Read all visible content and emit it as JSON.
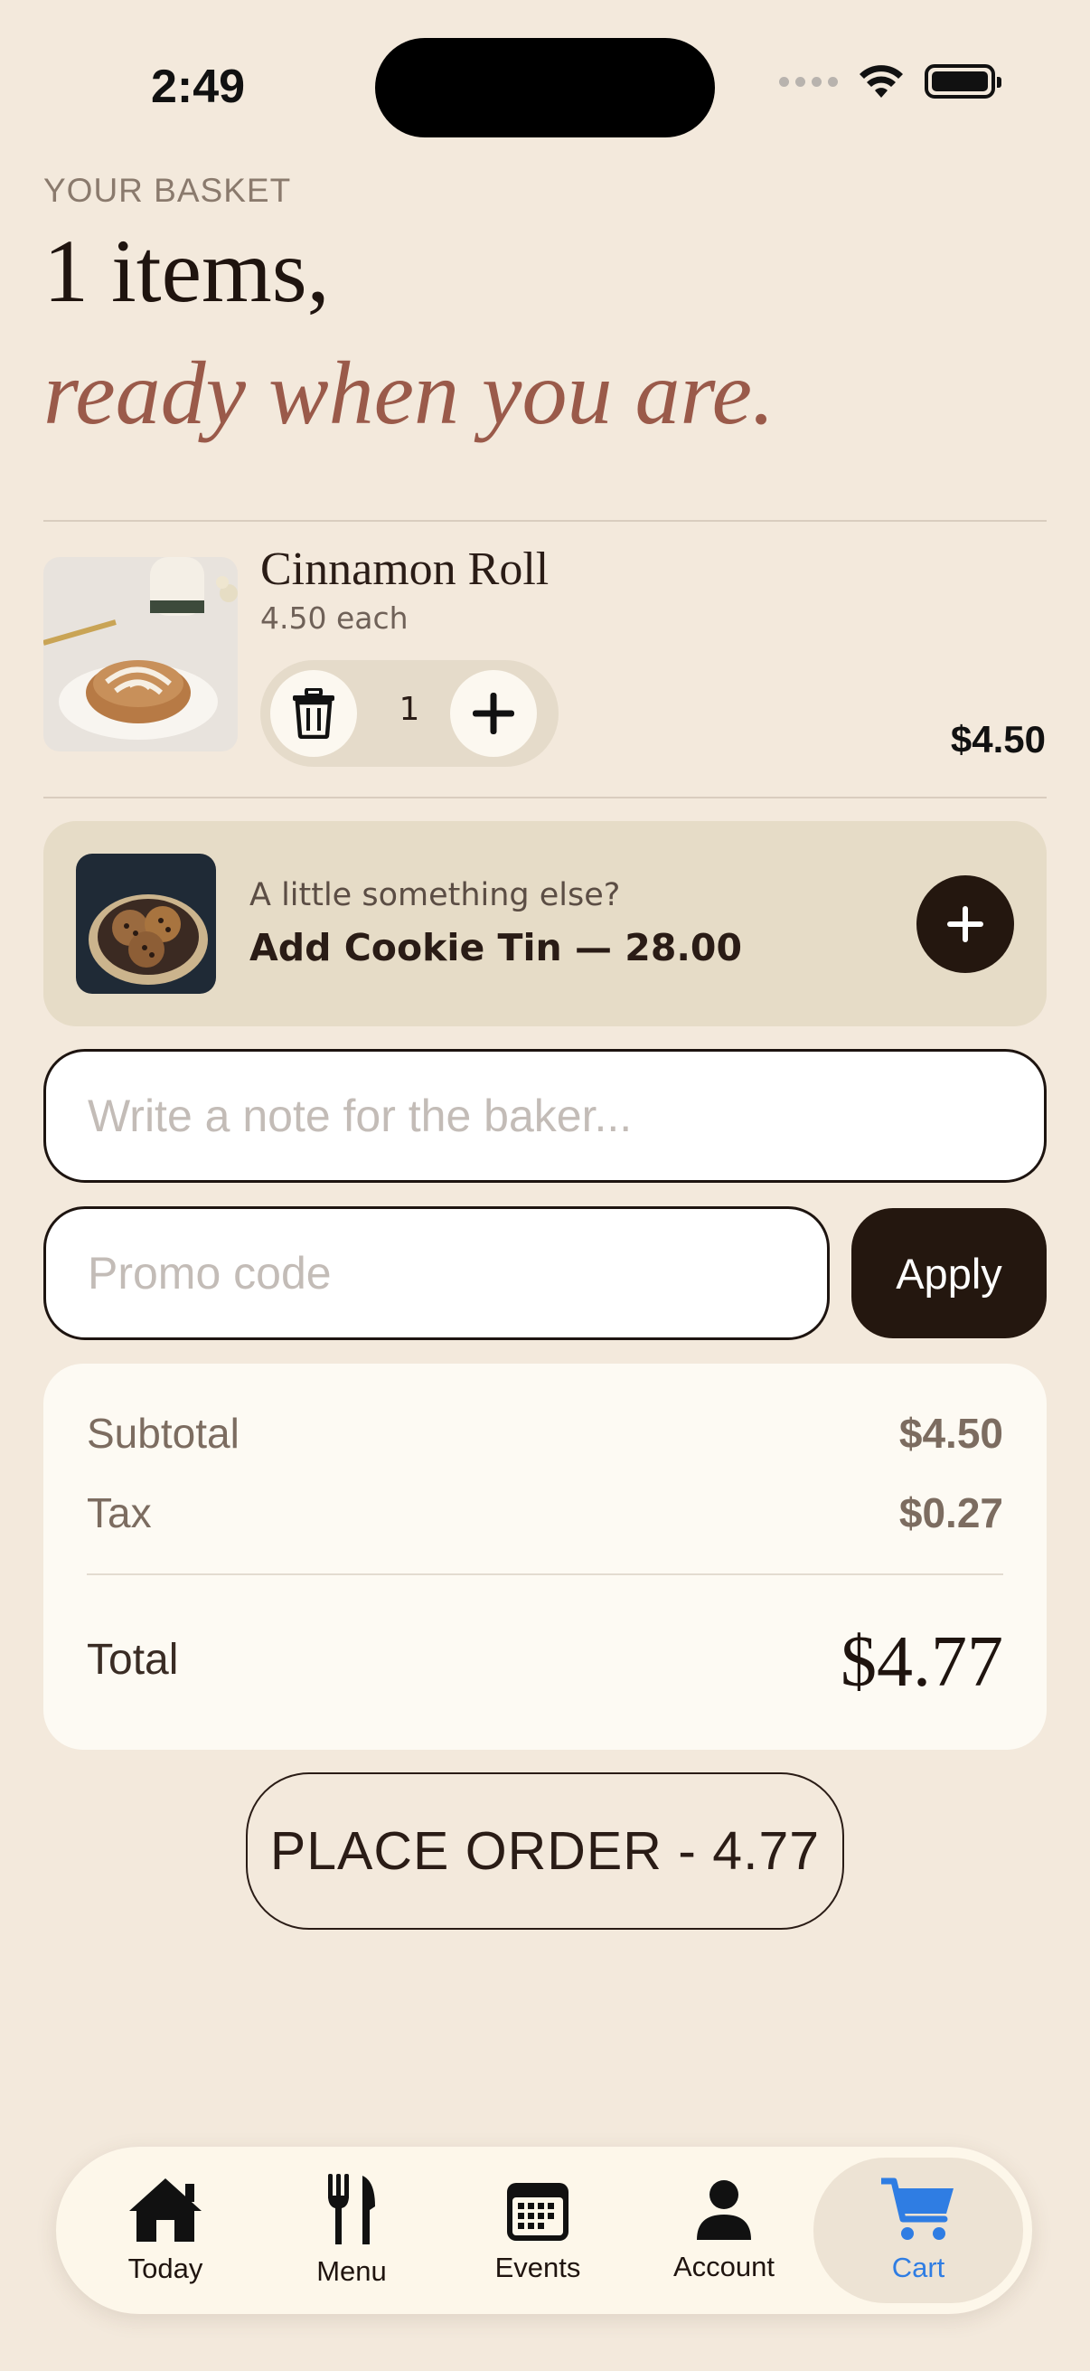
{
  "status_bar": {
    "time": "2:49"
  },
  "header": {
    "eyebrow": "YOUR BASKET",
    "headline": "1 items,",
    "subline": "ready when you are."
  },
  "cart_items": [
    {
      "name": "Cinnamon Roll",
      "unit_price": "4.50 each",
      "quantity": "1",
      "line_total": "$4.50"
    }
  ],
  "upsell": {
    "kicker": "A little something else?",
    "title": "Add Cookie Tin — 28.00"
  },
  "note_field": {
    "placeholder": "Write a note for the baker...",
    "value": ""
  },
  "promo": {
    "placeholder": "Promo code",
    "value": "",
    "apply_label": "Apply"
  },
  "summary": {
    "subtotal_label": "Subtotal",
    "subtotal_value": "$4.50",
    "tax_label": "Tax",
    "tax_value": "$0.27",
    "total_label": "Total",
    "total_value": "$4.77"
  },
  "place_order_label": "PLACE ORDER - 4.77",
  "tabs": [
    {
      "label": "Today",
      "icon": "home-icon"
    },
    {
      "label": "Menu",
      "icon": "fork-knife-icon"
    },
    {
      "label": "Events",
      "icon": "calendar-icon"
    },
    {
      "label": "Account",
      "icon": "person-icon"
    },
    {
      "label": "Cart",
      "icon": "cart-icon",
      "active": true
    }
  ],
  "colors": {
    "background": "#f3e9dc",
    "accent_dark": "#24170f",
    "accent_rose": "#9a5a4a",
    "active_tab": "#2f7de3"
  }
}
